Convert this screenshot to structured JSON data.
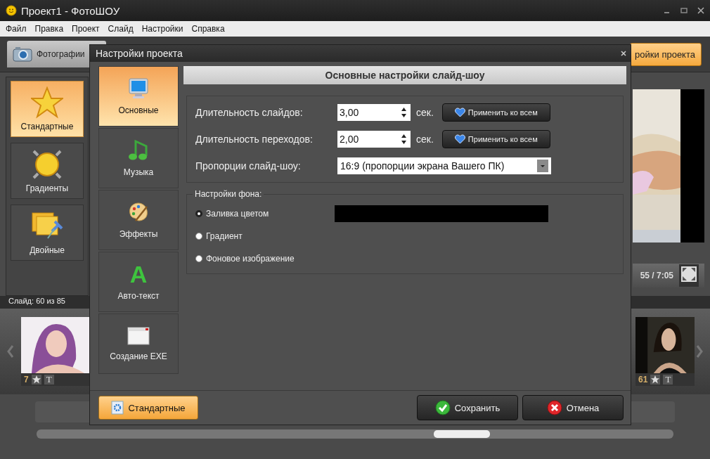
{
  "window": {
    "title": "Проект1 - ФотоШОУ"
  },
  "menu": [
    "Файл",
    "Правка",
    "Проект",
    "Слайд",
    "Настройки",
    "Справка"
  ],
  "toolbar": {
    "photos_tab": "Фотографии",
    "settings_button": "ройки проекта"
  },
  "styles": [
    {
      "label": "Стандартные",
      "kind": "star",
      "selected": true
    },
    {
      "label": "Градиенты",
      "kind": "gradient",
      "selected": false
    },
    {
      "label": "Двойные",
      "kind": "double",
      "selected": false
    }
  ],
  "player": {
    "time": "55 / 7:05"
  },
  "slides": {
    "counter": "Слайд: 60 из 85",
    "thumbs": [
      {
        "number": "7",
        "mark": "T"
      },
      {
        "number": "61",
        "mark": "T"
      }
    ]
  },
  "dialog": {
    "title": "Настройки проекта",
    "sections": [
      {
        "label": "Основные",
        "kind": "monitor",
        "selected": true
      },
      {
        "label": "Музыка",
        "kind": "music",
        "selected": false
      },
      {
        "label": "Эффекты",
        "kind": "palette",
        "selected": false
      },
      {
        "label": "Авто-текст",
        "kind": "letter",
        "glyph": "A",
        "selected": false
      },
      {
        "label": "Создание EXE",
        "kind": "window",
        "selected": false
      }
    ],
    "header": "Основные настройки слайд-шоу",
    "durations": [
      {
        "label": "Длительность слайдов:",
        "value": "3,00",
        "unit": "сек.",
        "button": "Применить ко всем"
      },
      {
        "label": "Длительность переходов:",
        "value": "2,00",
        "unit": "сек.",
        "button": "Применить ко всем"
      }
    ],
    "aspect": {
      "label": "Пропорции слайд-шоу:",
      "value": "16:9  (пропорции экрана Вашего ПК)"
    },
    "background": {
      "legend": "Настройки фона:",
      "color": "#000000",
      "options": [
        {
          "label": "Заливка цветом",
          "selected": true
        },
        {
          "label": "Градиент",
          "selected": false
        },
        {
          "label": "Фоновое изображение",
          "selected": false
        }
      ]
    },
    "defaults_button": "Стандартные",
    "save_button": "Сохранить",
    "cancel_button": "Отмена"
  }
}
